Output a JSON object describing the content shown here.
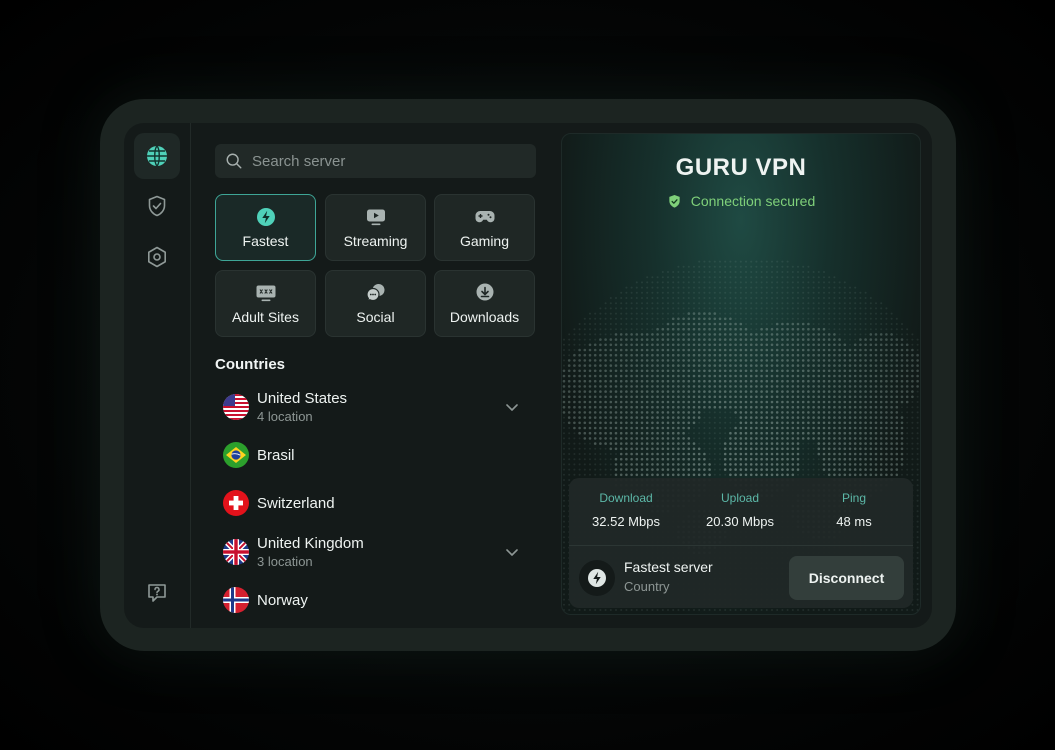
{
  "app": {
    "title": "GURU VPN",
    "status": "Connection secured"
  },
  "rail": {
    "icons": [
      "globe-icon",
      "shield-check-icon",
      "settings-icon",
      "help-icon"
    ]
  },
  "search": {
    "placeholder": "Search server"
  },
  "categories": [
    {
      "label": "Fastest",
      "icon": "bolt-icon",
      "active": true
    },
    {
      "label": "Streaming",
      "icon": "play-icon",
      "active": false
    },
    {
      "label": "Gaming",
      "icon": "gamepad-icon",
      "active": false
    },
    {
      "label": "Adult Sites",
      "icon": "xxx-icon",
      "active": false
    },
    {
      "label": "Social",
      "icon": "chat-icon",
      "active": false
    },
    {
      "label": "Downloads",
      "icon": "download-icon",
      "active": false
    }
  ],
  "countries": {
    "title": "Countries",
    "items": [
      {
        "name": "United States",
        "sub": "4 location",
        "flag": "us-flag-icon",
        "expandable": true
      },
      {
        "name": "Brasil",
        "sub": "",
        "flag": "brazil-flag-icon",
        "expandable": false
      },
      {
        "name": "Switzerland",
        "sub": "",
        "flag": "switzerland-flag-icon",
        "expandable": false
      },
      {
        "name": "United Kingdom",
        "sub": "3 location",
        "flag": "uk-flag-icon",
        "expandable": true
      },
      {
        "name": "Norway",
        "sub": "",
        "flag": "norway-flag-icon",
        "expandable": false
      }
    ]
  },
  "stats": {
    "download": {
      "label": "Download",
      "value": "32.52 Mbps"
    },
    "upload": {
      "label": "Upload",
      "value": "20.30 Mbps"
    },
    "ping": {
      "label": "Ping",
      "value": "48 ms"
    }
  },
  "server": {
    "name": "Fastest server",
    "sub": "Country",
    "action": "Disconnect"
  },
  "colors": {
    "accent": "#3ea596",
    "secure": "#7fd07a",
    "panel": "#141a19"
  }
}
